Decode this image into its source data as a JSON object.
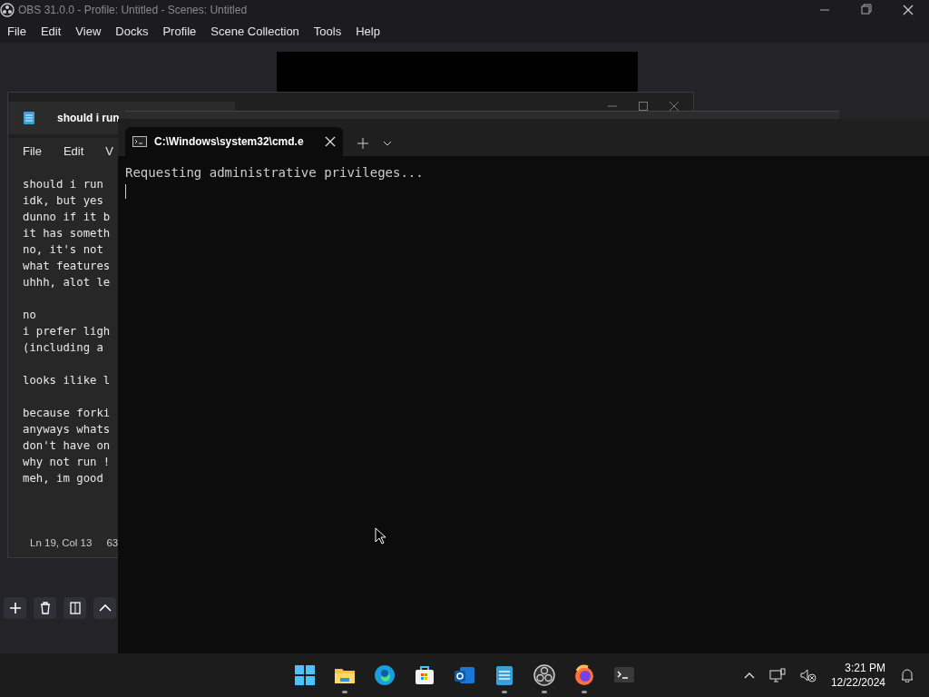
{
  "obs": {
    "title": "OBS 31.0.0 - Profile: Untitled - Scenes: Untitled",
    "menu": [
      "File",
      "Edit",
      "View",
      "Docks",
      "Profile",
      "Scene Collection",
      "Tools",
      "Help"
    ]
  },
  "notepad": {
    "tab_title": "should i run",
    "menu": [
      "File",
      "Edit",
      "V"
    ],
    "paragraphs": [
      [
        "should i run",
        "idk, but yes",
        "dunno if it b",
        "it has someth",
        "no, it's not",
        "what features",
        "uhhh, alot le"
      ],
      [
        "no",
        "i prefer ligh",
        "(including a"
      ],
      [
        "looks ilike l"
      ],
      [
        "because forki",
        "anyways whats",
        "don't have on",
        "why not run !",
        "meh, im good"
      ]
    ],
    "status": [
      "Ln 19, Col 13",
      "63"
    ]
  },
  "terminal": {
    "tab_title": "C:\\Windows\\system32\\cmd.e",
    "output": "Requesting administrative privileges..."
  },
  "taskbar": {
    "apps": [
      {
        "kind": "start",
        "running": false
      },
      {
        "kind": "files",
        "running": true
      },
      {
        "kind": "edge",
        "running": false
      },
      {
        "kind": "store",
        "running": false
      },
      {
        "kind": "mail",
        "running": false
      },
      {
        "kind": "notepad",
        "running": true
      },
      {
        "kind": "obs",
        "running": true
      },
      {
        "kind": "firefox",
        "running": true
      },
      {
        "kind": "terminal",
        "running": false
      }
    ],
    "time": "3:21 PM",
    "date": "12/22/2024"
  }
}
